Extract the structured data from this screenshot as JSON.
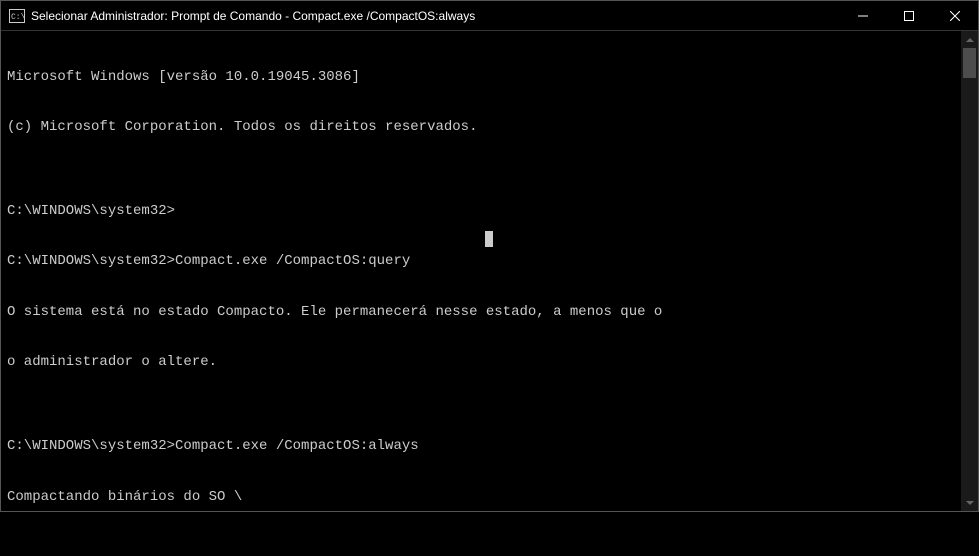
{
  "window": {
    "title": "Selecionar Administrador: Prompt de Comando - Compact.exe  /CompactOS:always"
  },
  "terminal": {
    "lines": [
      "Microsoft Windows [versão 10.0.19045.3086]",
      "(c) Microsoft Corporation. Todos os direitos reservados.",
      "",
      "C:\\WINDOWS\\system32>",
      "C:\\WINDOWS\\system32>Compact.exe /CompactOS:query",
      "O sistema está no estado Compacto. Ele permanecerá nesse estado, a menos que o",
      "o administrador o altere.",
      "",
      "C:\\WINDOWS\\system32>Compact.exe /CompactOS:always",
      "Compactando binários do SO \\"
    ]
  }
}
